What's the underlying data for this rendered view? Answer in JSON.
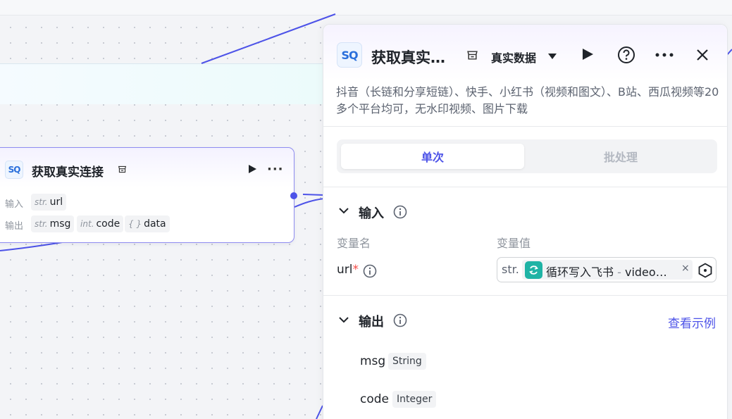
{
  "node": {
    "title": "获取真实连接",
    "input_label": "输入",
    "output_label": "输出",
    "input_param": {
      "type": "str.",
      "name": "url"
    },
    "outputs": [
      {
        "type": "str.",
        "name": "msg"
      },
      {
        "type": "int.",
        "name": "code"
      },
      {
        "type": "{ }",
        "name": "data"
      }
    ]
  },
  "panel": {
    "logo_text": "SQ",
    "title": "获取真实…",
    "source_select": "真实数据",
    "description": "抖音（长链和分享短链）、快手、小红书（视频和图文）、B站、西瓜视频等20多个平台均可，无水印视频、图片下载",
    "tabs": [
      "单次",
      "批处理"
    ],
    "input_section": {
      "title": "输入",
      "col_name": "变量名",
      "col_value": "变量值",
      "var_name": "url",
      "required_mark": "*",
      "value_type": "str.",
      "value_source": "循环写入飞书",
      "value_sep": "-",
      "value_field": "video…",
      "clear": "×"
    },
    "output_section": {
      "title": "输出",
      "example_link": "查看示例",
      "fields": [
        {
          "name": "msg",
          "type": "String"
        },
        {
          "name": "code",
          "type": "Integer"
        }
      ]
    }
  },
  "colors": {
    "accent": "#4d53e8",
    "wire": "#4d53e8",
    "teal": "#1fb3a5"
  },
  "icons": [
    "play-icon",
    "help-icon",
    "more-icon",
    "close-icon",
    "store-icon",
    "chevron-down-icon",
    "info-icon",
    "loop-icon",
    "hexagon-icon"
  ]
}
